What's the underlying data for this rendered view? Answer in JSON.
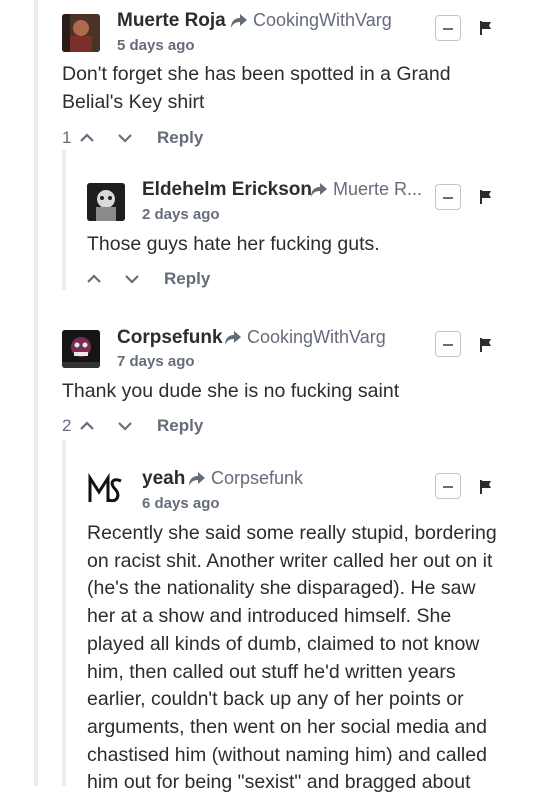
{
  "comments": [
    {
      "author": "Muerte Roja",
      "reply_to": "CookingWithVarg",
      "timestamp": "5 days ago",
      "body": "Don't forget she has been spotted in a Grand Belial's Key shirt",
      "votes": "1",
      "reply_label": "Reply"
    },
    {
      "author": "Eldehelm Erickson",
      "reply_to": "Muerte R...",
      "timestamp": "2 days ago",
      "body": "Those guys hate her fucking guts.",
      "votes": "",
      "reply_label": "Reply"
    },
    {
      "author": "Corpsefunk",
      "reply_to": "CookingWithVarg",
      "timestamp": "7 days ago",
      "body": "Thank you dude she is no fucking saint",
      "votes": "2",
      "reply_label": "Reply"
    },
    {
      "author": "yeah",
      "reply_to": "Corpsefunk",
      "timestamp": "6 days ago",
      "body": "Recently she said some really stupid, bordering on racist shit. Another writer called her out on it (he's the nationality she disparaged). He saw her at a show and introduced himself. She played all kinds of dumb, claimed to not know him, then called out stuff he'd written years earlier, couldn't back up any of her points or arguments, then went on her social media and chastised him (without naming him) and called him out for being \"sexist\" and bragged about",
      "votes": "",
      "reply_label": "Reply"
    }
  ],
  "colors": {
    "text": "#2a2e2e",
    "muted": "#656c7a",
    "thread_line": "#ececec"
  },
  "icons": [
    "reply-arrow-icon",
    "collapse-icon",
    "flag-icon",
    "upvote-icon",
    "downvote-icon"
  ]
}
